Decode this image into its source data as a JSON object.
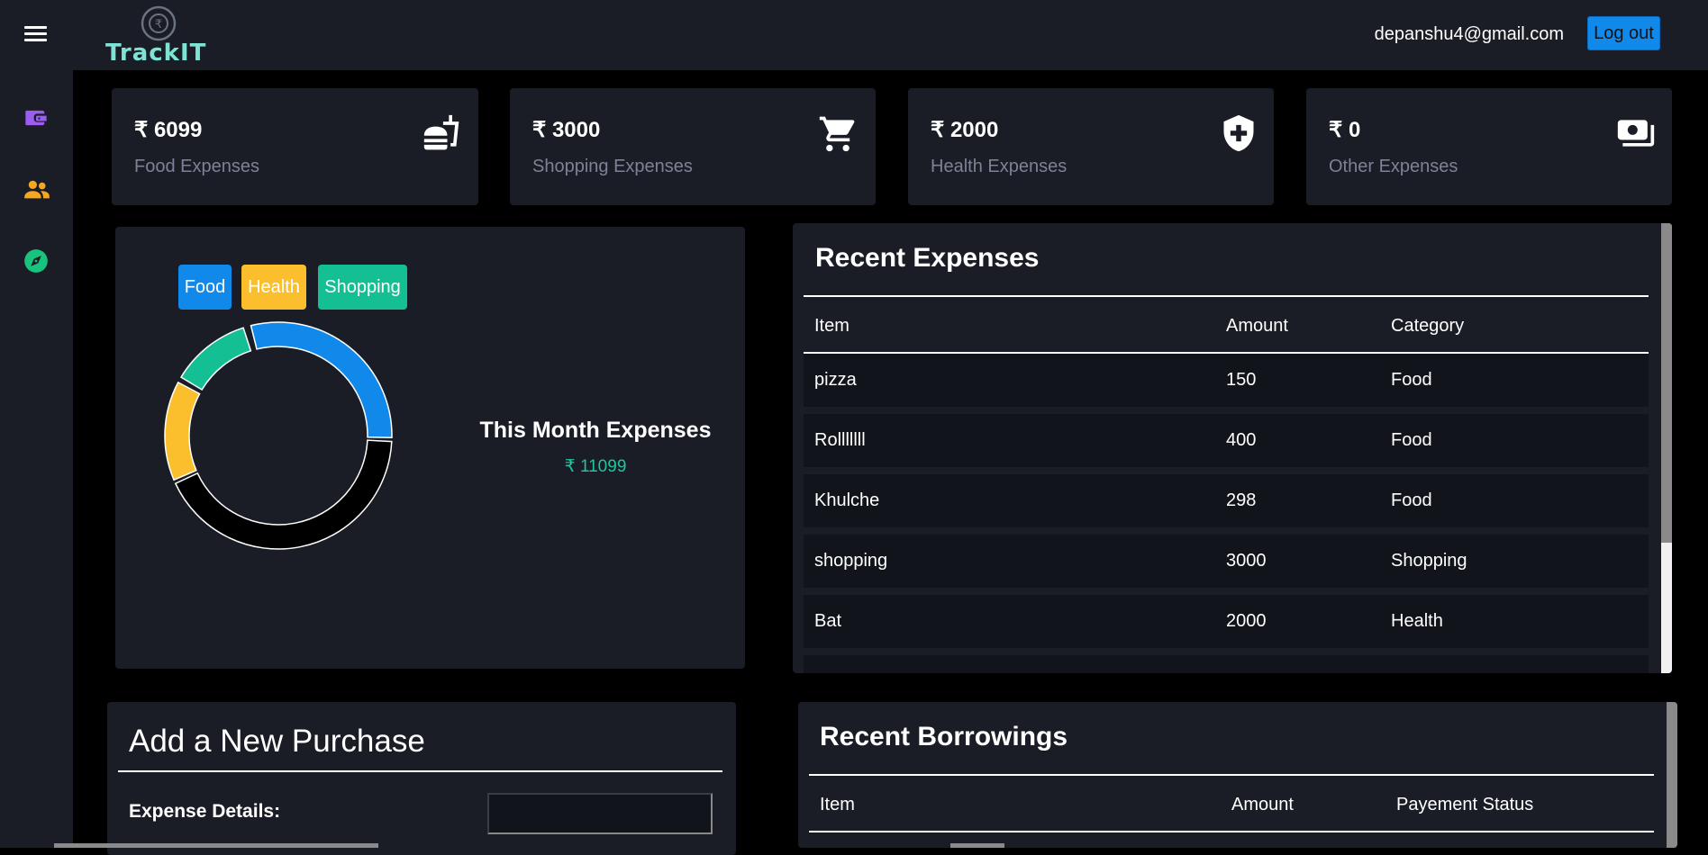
{
  "header": {
    "app_name": "TrackIT",
    "user_email": "depanshu4@gmail.com",
    "logout_label": "Log out"
  },
  "sidebar": {
    "items": [
      {
        "icon": "wallet-icon",
        "color": "#9b5cf0"
      },
      {
        "icon": "people-icon",
        "color": "#f5a623"
      },
      {
        "icon": "compass-icon",
        "color": "#19c37d"
      }
    ]
  },
  "summary_cards": [
    {
      "value": "₹ 6099",
      "label": "Food Expenses",
      "icon": "fastfood-icon"
    },
    {
      "value": "₹ 3000",
      "label": "Shopping Expenses",
      "icon": "cart-icon"
    },
    {
      "value": "₹ 2000",
      "label": "Health Expenses",
      "icon": "health-shield-icon"
    },
    {
      "value": "₹ 0",
      "label": "Other Expenses",
      "icon": "money-icon"
    }
  ],
  "chart_data": {
    "type": "pie",
    "categories": [
      "Food",
      "Health",
      "Shopping"
    ],
    "colors": [
      "#1089ea",
      "#fbbf2d",
      "#14bf93"
    ],
    "legend_position": "top-left",
    "total_color": "#22c59a",
    "title": "This Month Expenses",
    "total": "₹ 11099"
  },
  "recent_expenses": {
    "title": "Recent Expenses",
    "headers": [
      "Item",
      "Amount",
      "Category"
    ],
    "rows": [
      [
        "pizza",
        "150",
        "Food"
      ],
      [
        "Rolllllll",
        "400",
        "Food"
      ],
      [
        "Khulche",
        "298",
        "Food"
      ],
      [
        "shopping",
        "3000",
        "Shopping"
      ],
      [
        "Bat",
        "2000",
        "Health"
      ]
    ]
  },
  "recent_borrowings": {
    "title": "Recent Borrowings",
    "headers": [
      "Item",
      "Amount",
      "Payement Status"
    ]
  },
  "new_purchase": {
    "title": "Add a New Purchase",
    "expense_details_label": "Expense Details:",
    "expense_details_value": ""
  }
}
